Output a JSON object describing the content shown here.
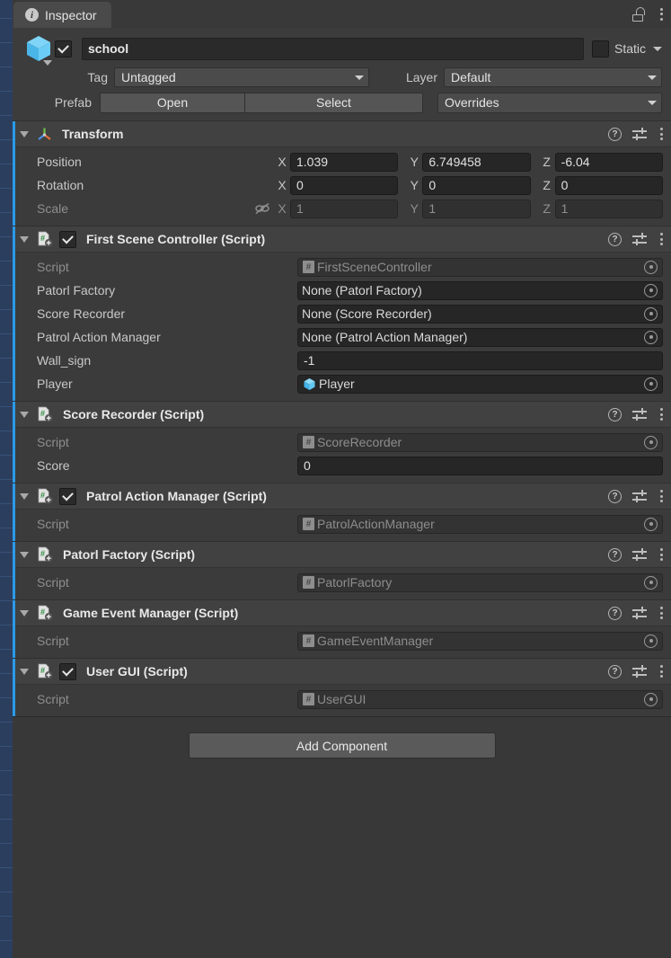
{
  "window": {
    "tab_label": "Inspector",
    "info_glyph": "i",
    "lock_icon": "lock-open-icon",
    "menu_icon": "kebab-menu-icon"
  },
  "colors": {
    "panel_bg": "#383838",
    "header_bg": "#414141",
    "accent_blue": "#2b9ae8",
    "field_bg": "#262626",
    "text": "#d2d2d2"
  },
  "gameobject": {
    "icon": "prefab-cube-icon",
    "enabled": true,
    "name": "school",
    "name_placeholder": "Name",
    "static_label": "Static",
    "static_checked": false,
    "tag_label": "Tag",
    "tag_value": "Untagged",
    "layer_label": "Layer",
    "layer_value": "Default",
    "prefab_label": "Prefab",
    "prefab_open": "Open",
    "prefab_select": "Select",
    "prefab_overrides": "Overrides"
  },
  "header_icons": {
    "help": "?",
    "preset": "preset-icon",
    "menu": "kebab-menu-icon"
  },
  "components": [
    {
      "title": "Transform",
      "icon": "transform-axis-icon",
      "has_toggle": false,
      "enabled": false,
      "kind": "transform",
      "vectors": [
        {
          "label": "Position",
          "dim": false,
          "link": false,
          "axes": [
            {
              "axis": "X",
              "value": "1.039"
            },
            {
              "axis": "Y",
              "value": "6.749458"
            },
            {
              "axis": "Z",
              "value": "-6.04"
            }
          ]
        },
        {
          "label": "Rotation",
          "dim": false,
          "link": false,
          "axes": [
            {
              "axis": "X",
              "value": "0"
            },
            {
              "axis": "Y",
              "value": "0"
            },
            {
              "axis": "Z",
              "value": "0"
            }
          ]
        },
        {
          "label": "Scale",
          "dim": true,
          "link": true,
          "axes": [
            {
              "axis": "X",
              "value": "1"
            },
            {
              "axis": "Y",
              "value": "1"
            },
            {
              "axis": "Z",
              "value": "1"
            }
          ]
        }
      ]
    },
    {
      "title": "First Scene Controller (Script)",
      "icon": "cs-script-icon",
      "has_toggle": true,
      "enabled": true,
      "kind": "script",
      "rows": [
        {
          "label": "Script",
          "dim": true,
          "type": "object",
          "value": "FirstSceneController",
          "value_icon": "script-mini-icon",
          "picker": true
        },
        {
          "label": "Patorl Factory",
          "dim": false,
          "type": "object",
          "value": "None (Patorl Factory)",
          "value_icon": null,
          "picker": true
        },
        {
          "label": "Score Recorder",
          "dim": false,
          "type": "object",
          "value": "None (Score Recorder)",
          "value_icon": null,
          "picker": true
        },
        {
          "label": "Patrol Action Manager",
          "dim": false,
          "type": "object",
          "value": "None (Patrol Action Manager)",
          "value_icon": null,
          "picker": true
        },
        {
          "label": "Wall_sign",
          "dim": false,
          "type": "text",
          "value": "-1",
          "value_icon": null,
          "picker": false
        },
        {
          "label": "Player",
          "dim": false,
          "type": "object",
          "value": "Player",
          "value_icon": "cube-mini-icon",
          "picker": true
        }
      ]
    },
    {
      "title": "Score Recorder (Script)",
      "icon": "cs-script-icon",
      "has_toggle": false,
      "enabled": false,
      "kind": "script",
      "rows": [
        {
          "label": "Script",
          "dim": true,
          "type": "object",
          "value": "ScoreRecorder",
          "value_icon": "script-mini-icon",
          "picker": true
        },
        {
          "label": "Score",
          "dim": false,
          "type": "text",
          "value": "0",
          "value_icon": null,
          "picker": false
        }
      ]
    },
    {
      "title": "Patrol Action Manager (Script)",
      "icon": "cs-script-icon",
      "has_toggle": true,
      "enabled": true,
      "kind": "script",
      "rows": [
        {
          "label": "Script",
          "dim": true,
          "type": "object",
          "value": "PatrolActionManager",
          "value_icon": "script-mini-icon",
          "picker": true
        }
      ]
    },
    {
      "title": "Patorl Factory (Script)",
      "icon": "cs-script-icon",
      "has_toggle": false,
      "enabled": false,
      "kind": "script",
      "rows": [
        {
          "label": "Script",
          "dim": true,
          "type": "object",
          "value": "PatorlFactory",
          "value_icon": "script-mini-icon",
          "picker": true
        }
      ]
    },
    {
      "title": "Game Event Manager (Script)",
      "icon": "cs-script-icon",
      "has_toggle": false,
      "enabled": false,
      "kind": "script",
      "rows": [
        {
          "label": "Script",
          "dim": true,
          "type": "object",
          "value": "GameEventManager",
          "value_icon": "script-mini-icon",
          "picker": true
        }
      ]
    },
    {
      "title": "User GUI (Script)",
      "icon": "cs-script-icon",
      "has_toggle": true,
      "enabled": true,
      "kind": "script",
      "rows": [
        {
          "label": "Script",
          "dim": true,
          "type": "object",
          "value": "UserGUI",
          "value_icon": "script-mini-icon",
          "picker": true
        }
      ]
    }
  ],
  "add_component": {
    "label": "Add Component"
  }
}
